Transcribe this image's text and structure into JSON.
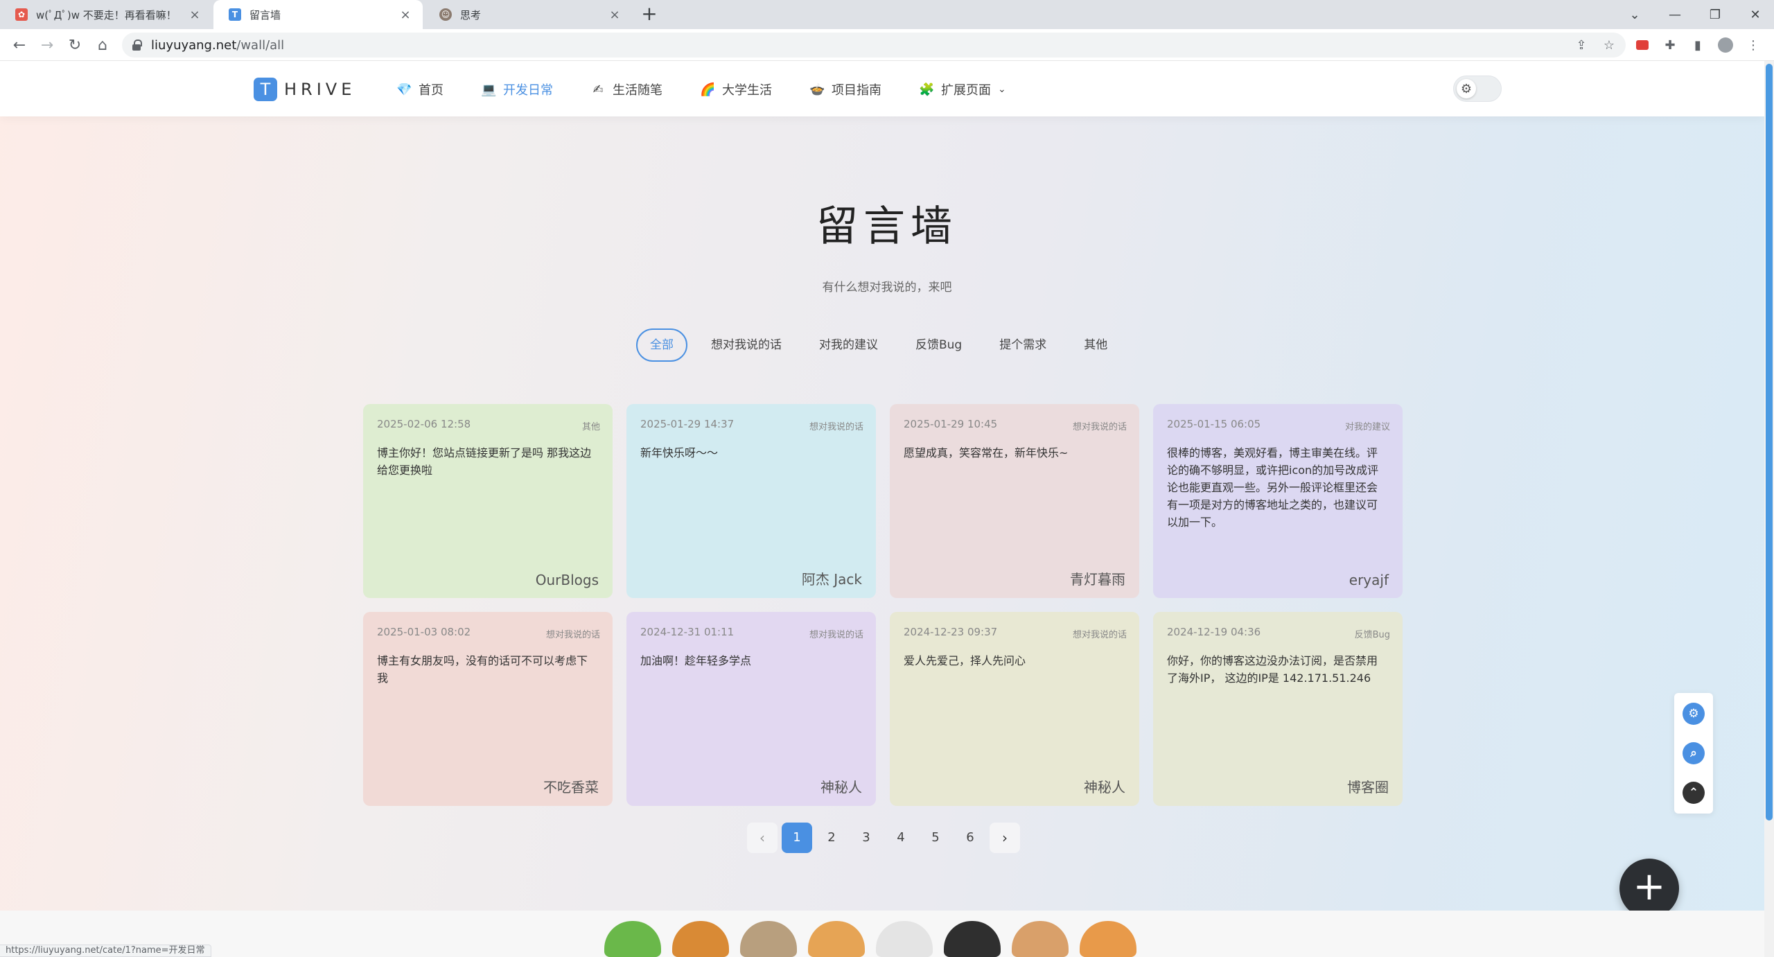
{
  "browser": {
    "tabs": [
      {
        "title": "w(ﾟДﾟ)w 不要走！再看看嘛！",
        "close": "×"
      },
      {
        "title": "留言墙",
        "close": "×"
      },
      {
        "title": "思考",
        "close": "×"
      }
    ],
    "new_tab": "+",
    "window_controls": {
      "chevron": "⌄",
      "minimize": "—",
      "restore": "❐",
      "close": "✕"
    },
    "url_host": "liuyuyang.net",
    "url_path": "/wall/all"
  },
  "site": {
    "logo_letter": "T",
    "logo_text": "HRIVE",
    "menu": [
      {
        "label": "首页",
        "icon": "💎"
      },
      {
        "label": "开发日常",
        "icon": "💻",
        "active": true
      },
      {
        "label": "生活随笔",
        "icon": "✍"
      },
      {
        "label": "大学生活",
        "icon": "🌈"
      },
      {
        "label": "项目指南",
        "icon": "🍲"
      },
      {
        "label": "扩展页面",
        "icon": "🧩",
        "caret": "⌄"
      }
    ],
    "theme_icon": "gear-icon"
  },
  "wall": {
    "title": "留言墙",
    "subtitle": "有什么想对我说的，来吧",
    "filters": [
      "全部",
      "想对我说的话",
      "对我的建议",
      "反馈Bug",
      "提个需求",
      "其他"
    ],
    "active_filter": "全部",
    "cards": [
      {
        "date": "2025-02-06 12:58",
        "category": "其他",
        "message": "博主你好！您站点链接更新了是吗 那我这边给您更换啦",
        "author": "OurBlogs",
        "color": "#deedd1"
      },
      {
        "date": "2025-01-29 14:37",
        "category": "想对我说的话",
        "message": "新年快乐呀～～",
        "author": "阿杰 Jack",
        "color": "#d2ebf1"
      },
      {
        "date": "2025-01-29 10:45",
        "category": "想对我说的话",
        "message": "愿望成真，笑容常在，新年快乐~",
        "author": "青灯暮雨",
        "color": "#ebdcdd"
      },
      {
        "date": "2025-01-15 06:05",
        "category": "对我的建议",
        "message": "很棒的博客，美观好看，博主审美在线。评论的确不够明显，或许把icon的加号改成评论也能更直观一些。另外一般评论框里还会有一项是对方的博客地址之类的，也建议可以加一下。",
        "author": "eryajf",
        "color": "#dcd8f2"
      },
      {
        "date": "2025-01-03 08:02",
        "category": "想对我说的话",
        "message": "博主有女朋友吗，没有的话可不可以考虑下我",
        "author": "不吃香菜",
        "color": "#f1dad6"
      },
      {
        "date": "2024-12-31 01:11",
        "category": "想对我说的话",
        "message": "加油啊！趁年轻多学点",
        "author": "神秘人",
        "color": "#e2d8f1"
      },
      {
        "date": "2024-12-23 09:37",
        "category": "想对我说的话",
        "message": "爱人先爱己，择人先问心",
        "author": "神秘人",
        "color": "#e8e8d3"
      },
      {
        "date": "2024-12-19 04:36",
        "category": "反馈Bug",
        "message": "你好，你的博客这边没办法订阅，是否禁用了海外IP，  这边的IP是 142.171.51.246",
        "author": "博客圈",
        "color": "#e6e8d5"
      }
    ]
  },
  "pagination": {
    "prev": "‹",
    "next": "›",
    "pages": [
      "1",
      "2",
      "3",
      "4",
      "5",
      "6"
    ],
    "current": 1
  },
  "fab_label": "+",
  "status_url": "https://liuyuyang.net/cate/1?name=开发日常",
  "colors": {
    "accent": "#4a90e2",
    "fab": "#2c2f33"
  }
}
